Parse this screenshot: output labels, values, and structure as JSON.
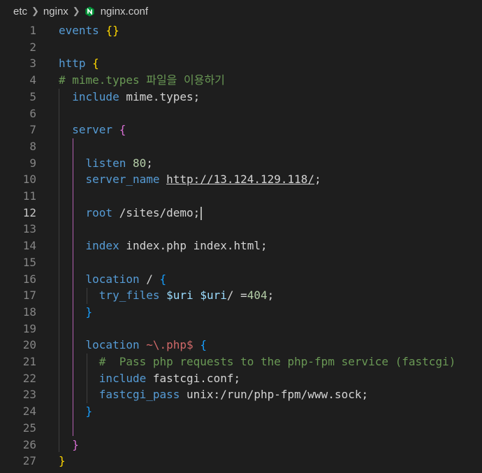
{
  "breadcrumb": {
    "segments": [
      "etc",
      "nginx",
      "nginx.conf"
    ],
    "file_icon": "nginx-icon",
    "separator_icon": "chevron-right-icon"
  },
  "editor": {
    "active_line": 12,
    "lines": [
      {
        "n": "1",
        "t": "events {}"
      },
      {
        "n": "2",
        "t": ""
      },
      {
        "n": "3",
        "t": "http {"
      },
      {
        "n": "4",
        "t": "# mime.types 파일을 이용하기"
      },
      {
        "n": "5",
        "t": "  include mime.types;"
      },
      {
        "n": "6",
        "t": ""
      },
      {
        "n": "7",
        "t": "  server {"
      },
      {
        "n": "8",
        "t": ""
      },
      {
        "n": "9",
        "t": "    listen 80;"
      },
      {
        "n": "10",
        "t": "    server_name http://13.124.129.118/;"
      },
      {
        "n": "11",
        "t": ""
      },
      {
        "n": "12",
        "t": "    root /sites/demo;"
      },
      {
        "n": "13",
        "t": ""
      },
      {
        "n": "14",
        "t": "    index index.php index.html;"
      },
      {
        "n": "15",
        "t": ""
      },
      {
        "n": "16",
        "t": "    location / {"
      },
      {
        "n": "17",
        "t": "      try_files $uri $uri/ =404;"
      },
      {
        "n": "18",
        "t": "    }"
      },
      {
        "n": "19",
        "t": ""
      },
      {
        "n": "20",
        "t": "    location ~\\.php$ {"
      },
      {
        "n": "21",
        "t": "      #  Pass php requests to the php-fpm service (fastcgi)"
      },
      {
        "n": "22",
        "t": "      include fastcgi.conf;"
      },
      {
        "n": "23",
        "t": "      fastcgi_pass unix:/run/php-fpm/www.sock;"
      },
      {
        "n": "24",
        "t": "    }"
      },
      {
        "n": "25",
        "t": ""
      },
      {
        "n": "26",
        "t": "  }"
      },
      {
        "n": "27",
        "t": "}"
      }
    ]
  },
  "colors": {
    "background": "#1e1e1e",
    "keyword": "#569cd6",
    "comment": "#6a9955",
    "number": "#b5cea8",
    "variable": "#9cdcfe",
    "bracket_gold": "#ffd700",
    "bracket_pink": "#da70d6",
    "bracket_blue": "#179fff",
    "regex": "#d16969"
  }
}
